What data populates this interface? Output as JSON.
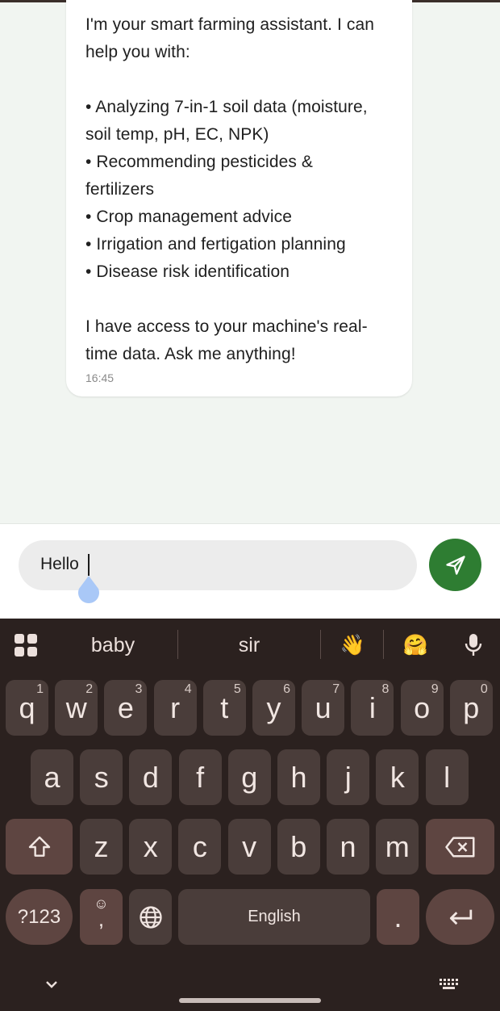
{
  "chat": {
    "message_lines": [
      "I'm your smart farming assistant. I can",
      "help you with:",
      "",
      "• Analyzing 7-in-1 soil data (moisture,",
      "soil temp, pH, EC, NPK)",
      "• Recommending pesticides &",
      "fertilizers",
      "• Crop management advice",
      "• Irrigation and fertigation planning",
      "• Disease risk identification",
      "",
      "I have access to your machine's real-",
      "time data. Ask me anything!"
    ],
    "time": "16:45"
  },
  "input": {
    "value": "Hello",
    "send_icon": "send-icon"
  },
  "keyboard": {
    "suggestions": [
      "baby",
      "sir",
      "👋",
      "🤗"
    ],
    "row1": [
      {
        "key": "q",
        "hint": "1"
      },
      {
        "key": "w",
        "hint": "2"
      },
      {
        "key": "e",
        "hint": "3"
      },
      {
        "key": "r",
        "hint": "4"
      },
      {
        "key": "t",
        "hint": "5"
      },
      {
        "key": "y",
        "hint": "6"
      },
      {
        "key": "u",
        "hint": "7"
      },
      {
        "key": "i",
        "hint": "8"
      },
      {
        "key": "o",
        "hint": "9"
      },
      {
        "key": "p",
        "hint": "0"
      }
    ],
    "row2": [
      "a",
      "s",
      "d",
      "f",
      "g",
      "h",
      "j",
      "k",
      "l"
    ],
    "row3": [
      "z",
      "x",
      "c",
      "v",
      "b",
      "n",
      "m"
    ],
    "symbols_label": "?123",
    "comma_label": ",",
    "space_label": "English",
    "period_label": ".",
    "colors": {
      "background": "#2b211f",
      "key": "#4a3d3a",
      "modifier": "#5e4541",
      "send": "#2e7d32"
    }
  }
}
